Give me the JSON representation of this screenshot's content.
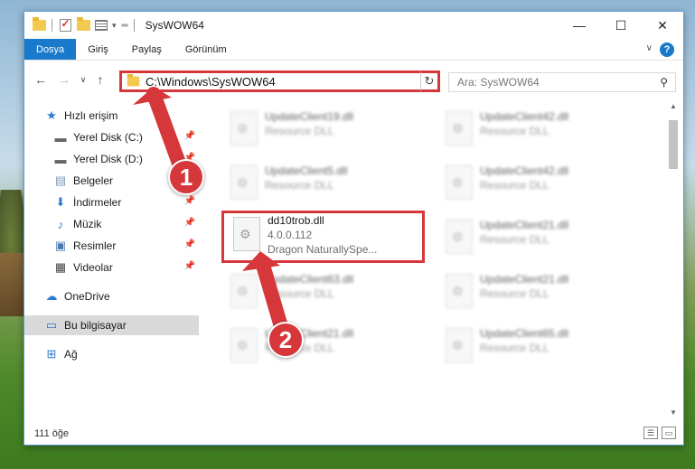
{
  "window": {
    "title": "SysWOW64",
    "controls": {
      "minimize": "—",
      "maximize": "☐",
      "close": "✕"
    }
  },
  "ribbon": {
    "tabs": [
      {
        "label": "Dosya",
        "active": true
      },
      {
        "label": "Giriş",
        "active": false
      },
      {
        "label": "Paylaş",
        "active": false
      },
      {
        "label": "Görünüm",
        "active": false
      }
    ],
    "help": "?"
  },
  "address": {
    "path": "C:\\Windows\\SysWOW64",
    "search_placeholder": "Ara: SysWOW64"
  },
  "nav_pane": {
    "items": [
      {
        "label": "Hızlı erişim",
        "icon": "star-icon",
        "pinned": false
      },
      {
        "label": "Yerel Disk (C:)",
        "icon": "drive-icon",
        "pinned": true
      },
      {
        "label": "Yerel Disk (D:)",
        "icon": "drive-icon",
        "pinned": true
      },
      {
        "label": "Belgeler",
        "icon": "documents-icon",
        "pinned": true
      },
      {
        "label": "İndirmeler",
        "icon": "download-icon",
        "pinned": true
      },
      {
        "label": "Müzik",
        "icon": "music-icon",
        "pinned": true
      },
      {
        "label": "Resimler",
        "icon": "pictures-icon",
        "pinned": true
      },
      {
        "label": "Videolar",
        "icon": "videos-icon",
        "pinned": true
      },
      {
        "label": "OneDrive",
        "icon": "cloud-icon",
        "pinned": false
      },
      {
        "label": "Bu bilgisayar",
        "icon": "computer-icon",
        "pinned": false,
        "selected": true
      },
      {
        "label": "Ağ",
        "icon": "network-icon",
        "pinned": false
      }
    ]
  },
  "files": {
    "left_column": [
      {
        "name": "UpdateClient19.dll",
        "line2": "Resource DLL",
        "line3": "",
        "blurred": true
      },
      {
        "name": "UpdateClient5.dll",
        "line2": "Resource DLL",
        "line3": "",
        "blurred": true
      },
      {
        "name": "dd10trob.dll",
        "line2": "4.0.0.112",
        "line3": "Dragon NaturallySpe...",
        "blurred": false,
        "selected": true
      },
      {
        "name": "UpdateClient63.dll",
        "line2": "Resource DLL",
        "line3": "",
        "blurred": true
      },
      {
        "name": "UpdateClient21.dll",
        "line2": "Resource DLL",
        "line3": "",
        "blurred": true
      }
    ],
    "right_column": [
      {
        "name": "UpdateClient42.dll",
        "line2": "Resource DLL",
        "blurred": true
      },
      {
        "name": "UpdateClient42.dll",
        "line2": "Resource DLL",
        "blurred": true
      },
      {
        "name": "UpdateClient21.dll",
        "line2": "Resource DLL",
        "blurred": true
      },
      {
        "name": "UpdateClient21.dll",
        "line2": "Resource DLL",
        "blurred": true
      },
      {
        "name": "UpdateClient65.dll",
        "line2": "Resource DLL",
        "blurred": true
      }
    ]
  },
  "status": {
    "count": "111 öğe"
  },
  "annotations": {
    "badge1": "1",
    "badge2": "2"
  },
  "colors": {
    "accent": "#1979ca",
    "highlight": "#d6373b"
  }
}
